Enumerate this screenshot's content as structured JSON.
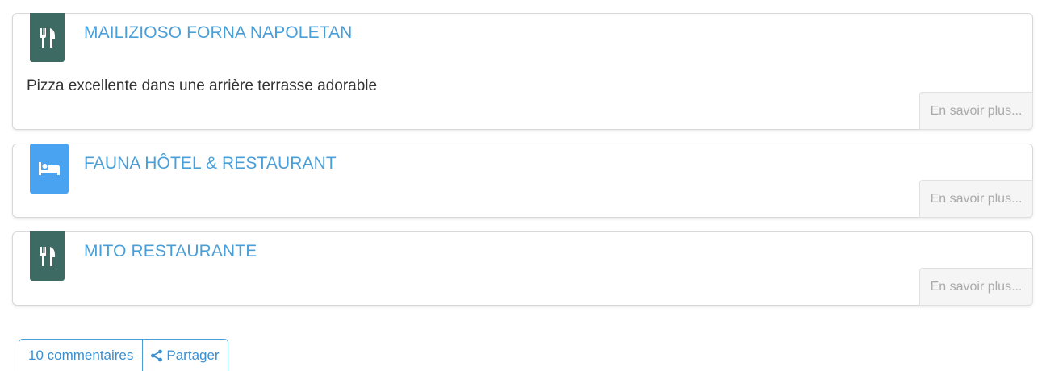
{
  "listings": [
    {
      "category_icon": "restaurant-icon",
      "title": "MAILIZIOSO FORNA NAPOLETAN",
      "description": "Pizza excellente dans une arrière terrasse adorable",
      "more_label": "En savoir plus..."
    },
    {
      "category_icon": "hotel-icon",
      "title": "FAUNA HÔTEL & RESTAURANT",
      "description": "",
      "more_label": "En savoir plus..."
    },
    {
      "category_icon": "restaurant-icon",
      "title": "MITO RESTAURANTE",
      "description": "",
      "more_label": "En savoir plus..."
    }
  ],
  "actions": {
    "comments_label": "10 commentaires",
    "share_label": "Partager",
    "share_icon": "share-icon"
  },
  "colors": {
    "title_blue": "#4a9fd8",
    "restaurant_badge": "#3d6a63",
    "hotel_badge": "#4aa3f0",
    "button_text": "#aaaaaa"
  }
}
